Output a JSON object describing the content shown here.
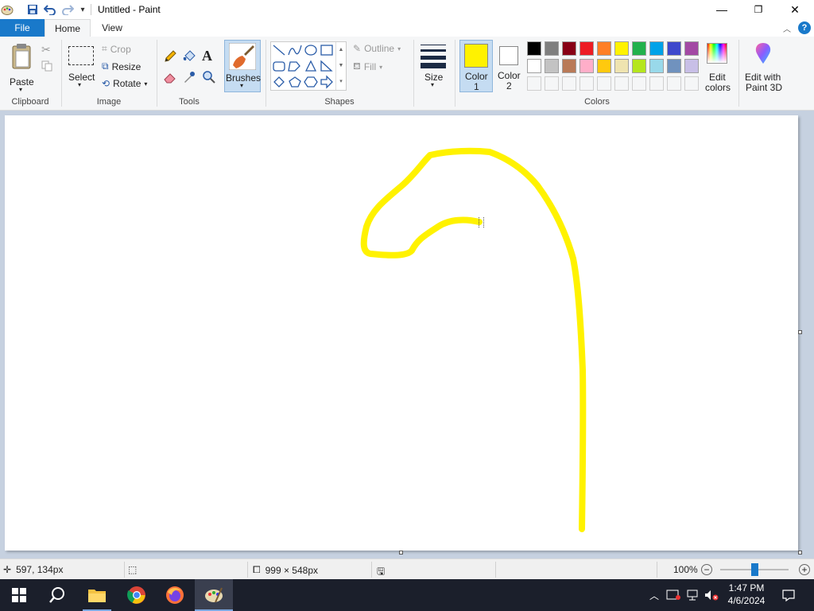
{
  "window": {
    "title": "Untitled - Paint",
    "minimize_glyph": "—",
    "maximize_glyph": "❐",
    "close_glyph": "✕"
  },
  "tabs": {
    "file": "File",
    "home": "Home",
    "view": "View"
  },
  "clipboard": {
    "paste": "Paste",
    "group": "Clipboard"
  },
  "image": {
    "select": "Select",
    "crop": "Crop",
    "resize": "Resize",
    "rotate": "Rotate",
    "group": "Image"
  },
  "tools": {
    "group": "Tools"
  },
  "brushes": {
    "label": "Brushes"
  },
  "shapes": {
    "outline": "Outline",
    "fill": "Fill",
    "group": "Shapes"
  },
  "size": {
    "label": "Size"
  },
  "colors": {
    "color1_line1": "Color",
    "color1_line2": "1",
    "color2_line1": "Color",
    "color2_line2": "2",
    "group": "Colors",
    "edit_line1": "Edit",
    "edit_line2": "colors",
    "paint3d_line1": "Edit with",
    "paint3d_line2": "Paint 3D",
    "color1_value": "#fff200",
    "color2_value": "#ffffff",
    "palette_row1": [
      "#000000",
      "#7f7f7f",
      "#880015",
      "#ed1c24",
      "#ff7f27",
      "#fff200",
      "#22b14c",
      "#00a2e8",
      "#3f48cc",
      "#a349a4"
    ],
    "palette_row2": [
      "#ffffff",
      "#c3c3c3",
      "#b97a57",
      "#ffaec9",
      "#ffc90e",
      "#efe4b0",
      "#b5e61d",
      "#99d9ea",
      "#7092be",
      "#c8bfe7"
    ]
  },
  "status": {
    "cursor_pos": "597, 134px",
    "canvas_size": "999 × 548px",
    "zoom": "100%",
    "zoom_level": 1.0
  },
  "tray": {
    "time": "1:47 PM",
    "date": "4/6/2024"
  }
}
